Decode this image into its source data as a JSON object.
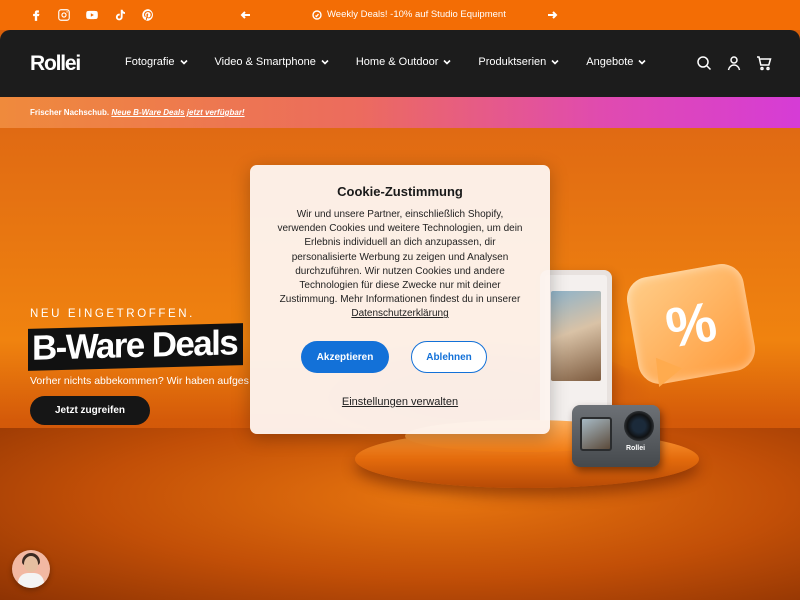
{
  "topbar": {
    "social": [
      "facebook-icon",
      "instagram-icon",
      "youtube-icon",
      "tiktok-icon",
      "pinterest-icon"
    ],
    "promo_text": "Weekly Deals! -10% auf Studio Equipment"
  },
  "header": {
    "logo": "Rollei",
    "nav": [
      "Fotografie",
      "Video & Smartphone",
      "Home & Outdoor",
      "Produktserien",
      "Angebote"
    ],
    "icons": [
      "search-icon",
      "account-icon",
      "cart-icon"
    ]
  },
  "notice": {
    "text": "Frischer Nachschub.",
    "link": "Neue B-Ware Deals jetzt verfügbar!"
  },
  "hero": {
    "eyebrow": "NEU EINGETROFFEN.",
    "title": "B-Ware Deals",
    "subtitle": "Vorher nichts abbekommen? Wir haben aufges",
    "cta": "Jetzt zugreifen",
    "discount_symbol": "%",
    "camera_brand": "Rollei"
  },
  "cookie": {
    "title": "Cookie-Zustimmung",
    "body": "Wir und unsere Partner, einschließlich Shopify, verwenden Cookies und weitere Technologien, um dein Erlebnis individuell an dich anzupassen, dir personalisierte Werbung zu zeigen und Analysen durchzuführen. Wir nutzen Cookies und andere Technologien für diese Zwecke nur mit deiner Zustimmung. Mehr Informationen findest du in unserer",
    "privacy_link": "Datenschutzerklärung",
    "accept": "Akzeptieren",
    "decline": "Ablehnen",
    "settings": "Einstellungen verwalten"
  },
  "colors": {
    "accent_orange": "#f36d05",
    "header_bg": "#1c1c1c",
    "button_blue": "#1371d8"
  }
}
